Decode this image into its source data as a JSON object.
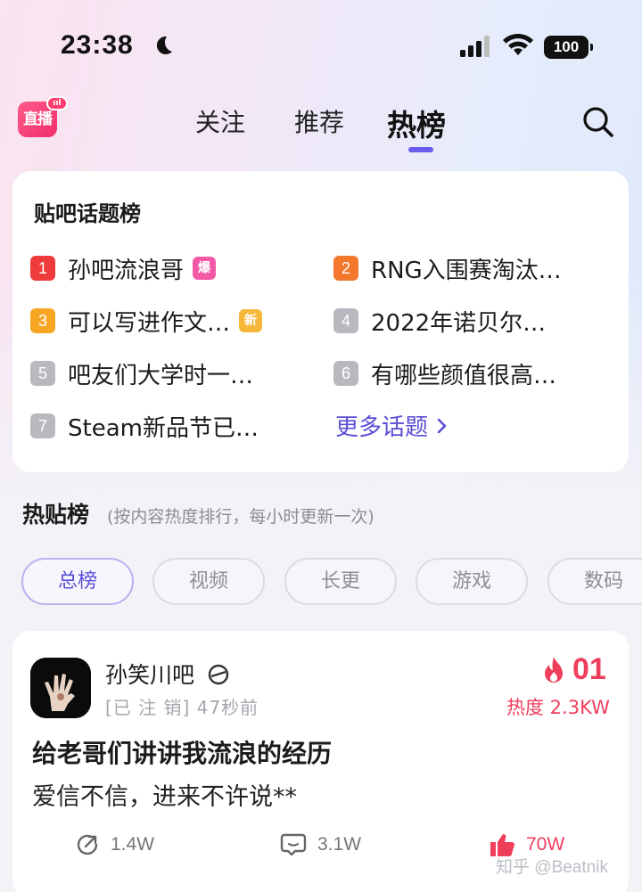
{
  "status_bar": {
    "time": "23:38",
    "battery": "100"
  },
  "nav": {
    "live_label": "直播",
    "tabs": [
      {
        "label": "关注"
      },
      {
        "label": "推荐"
      },
      {
        "label": "热榜"
      }
    ],
    "active_tab": "热榜"
  },
  "topic_board": {
    "title": "贴吧话题榜",
    "items": [
      {
        "rank": "1",
        "text": "孙吧流浪哥",
        "tag": "爆",
        "rank_color": "#ef3b3b",
        "tag_color": "#f35aa6"
      },
      {
        "rank": "2",
        "text": "RNG入围赛淘汰…",
        "tag": "",
        "rank_color": "#f4772e"
      },
      {
        "rank": "3",
        "text": "可以写进作文…",
        "tag": "新",
        "rank_color": "#f6a623",
        "tag_color": "#f6b73a"
      },
      {
        "rank": "4",
        "text": "2022年诺贝尔…",
        "tag": "",
        "rank_color": "#b8b8bf"
      },
      {
        "rank": "5",
        "text": "吧友们大学时一…",
        "tag": "",
        "rank_color": "#b8b8bf"
      },
      {
        "rank": "6",
        "text": "有哪些颜值很高…",
        "tag": "",
        "rank_color": "#b8b8bf"
      },
      {
        "rank": "7",
        "text": "Steam新品节已…",
        "tag": "",
        "rank_color": "#b8b8bf"
      }
    ],
    "more_label": "更多话题"
  },
  "hot_posts": {
    "title": "热贴榜",
    "subtitle": "(按内容热度排行，每小时更新一次)",
    "chips": [
      "总榜",
      "视频",
      "长更",
      "游戏",
      "数码"
    ],
    "active_chip": "总榜"
  },
  "post": {
    "author": "孙笑川吧",
    "meta": "[已 注 销] 47秒前",
    "rank": "01",
    "heat": "热度 2.3KW",
    "title": "给老哥们讲讲我流浪的经历",
    "excerpt": "爱信不信，进来不许说**",
    "shares": "1.4W",
    "comments": "3.1W",
    "likes": "70W"
  },
  "watermark": "知乎 @Beatnik",
  "colors": {
    "accent": "#5a4fd6",
    "hot": "#ef3e5c",
    "underline": "#6a5cf0"
  }
}
